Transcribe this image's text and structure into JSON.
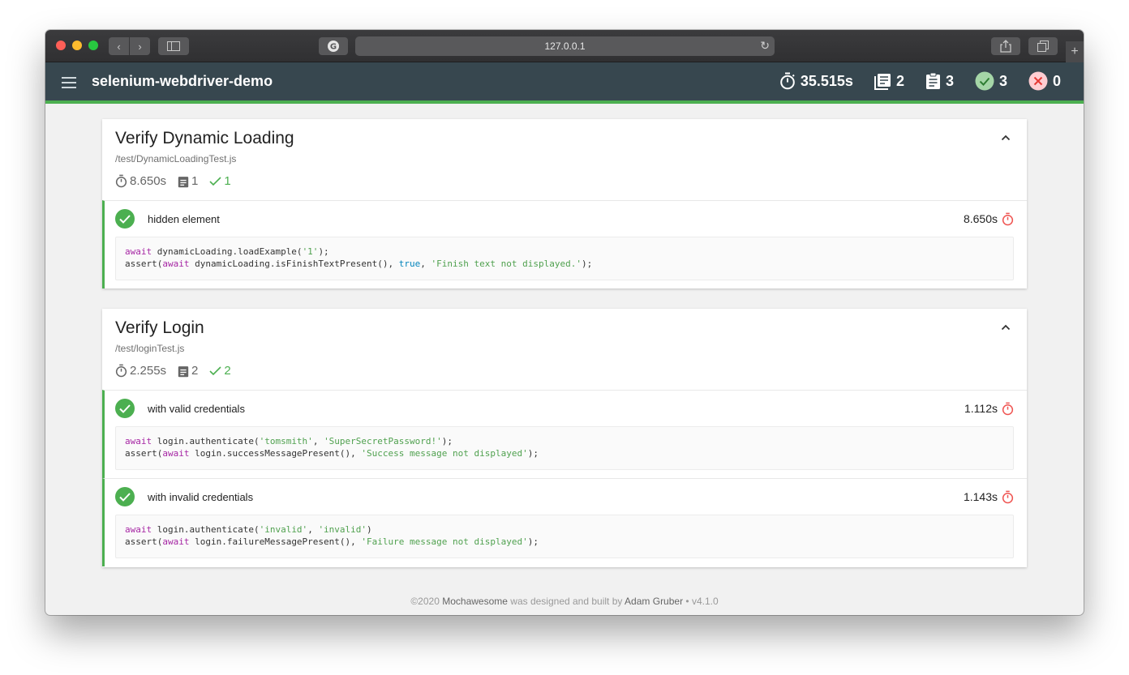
{
  "browser": {
    "address": "127.0.0.1"
  },
  "app": {
    "title": "selenium-webdriver-demo",
    "stats": {
      "duration": "35.515s",
      "suites": "2",
      "tests": "3",
      "passed": "3",
      "failed": "0"
    },
    "colors": {
      "navbar": "#37474f",
      "pass": "#4caf50",
      "fail": "#f44336"
    }
  },
  "suites": [
    {
      "title": "Verify Dynamic Loading",
      "file": "/test/DynamicLoadingTest.js",
      "duration": "8.650s",
      "tests": "1",
      "passed": "1",
      "cases": [
        {
          "title": "hidden element",
          "duration": "8.650s",
          "code": [
            [
              [
                "kw",
                "await"
              ],
              [
                "t",
                " dynamicLoading.loadExample("
              ],
              [
                "str",
                "'1'"
              ],
              [
                "t",
                ");"
              ]
            ],
            [
              [
                "t",
                "assert("
              ],
              [
                "kw",
                "await"
              ],
              [
                "t",
                " dynamicLoading.isFinishTextPresent(), "
              ],
              [
                "lit",
                "true"
              ],
              [
                "t",
                ", "
              ],
              [
                "str",
                "'Finish text not displayed.'"
              ],
              [
                "t",
                ");"
              ]
            ]
          ]
        }
      ]
    },
    {
      "title": "Verify Login",
      "file": "/test/loginTest.js",
      "duration": "2.255s",
      "tests": "2",
      "passed": "2",
      "cases": [
        {
          "title": "with valid credentials",
          "duration": "1.112s",
          "code": [
            [
              [
                "kw",
                "await"
              ],
              [
                "t",
                " login.authenticate("
              ],
              [
                "str",
                "'tomsmith'"
              ],
              [
                "t",
                ", "
              ],
              [
                "str",
                "'SuperSecretPassword!'"
              ],
              [
                "t",
                ");"
              ]
            ],
            [
              [
                "t",
                "assert("
              ],
              [
                "kw",
                "await"
              ],
              [
                "t",
                " login.successMessagePresent(), "
              ],
              [
                "str",
                "'Success message not displayed'"
              ],
              [
                "t",
                ");"
              ]
            ]
          ]
        },
        {
          "title": "with invalid credentials",
          "duration": "1.143s",
          "code": [
            [
              [
                "kw",
                "await"
              ],
              [
                "t",
                " login.authenticate("
              ],
              [
                "str",
                "'invalid'"
              ],
              [
                "t",
                ", "
              ],
              [
                "str",
                "'invalid'"
              ],
              [
                "t",
                ")"
              ]
            ],
            [
              [
                "t",
                "assert("
              ],
              [
                "kw",
                "await"
              ],
              [
                "t",
                " login.failureMessagePresent(), "
              ],
              [
                "str",
                "'Failure message not displayed'"
              ],
              [
                "t",
                ");"
              ]
            ]
          ]
        }
      ]
    }
  ],
  "footer": {
    "copyright": "©2020",
    "brand": "Mochawesome",
    "middle": "was designed and built by",
    "author": "Adam Gruber",
    "version": "• v4.1.0"
  }
}
